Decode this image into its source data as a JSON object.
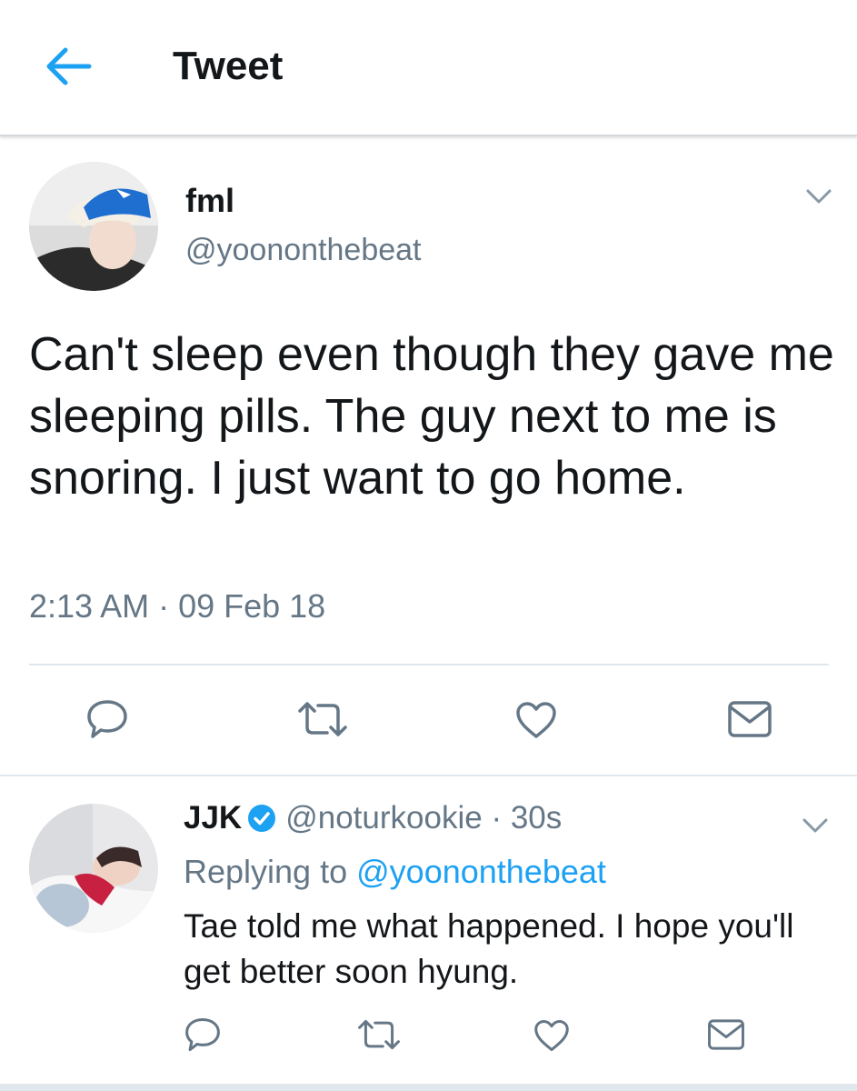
{
  "header": {
    "title": "Tweet",
    "back_icon": "arrow-left-icon"
  },
  "colors": {
    "accent": "#1da1f2",
    "text": "#14171a",
    "muted": "#657786",
    "divider": "#e1e8ed"
  },
  "tweet": {
    "display_name": "fml",
    "handle": "@yoononthebeat",
    "text": "Can't sleep even though they gave me sleeping pills. The guy next to me is snoring. I just want to go home.",
    "timestamp": "2:13 AM · 09 Feb 18",
    "actions": [
      "reply-icon",
      "retweet-icon",
      "like-icon",
      "message-icon"
    ]
  },
  "reply": {
    "display_name": "JJK",
    "handle": "@noturkookie",
    "time": "· 30s",
    "replying_prefix": "Replying to",
    "replying_to": "@yoononthebeat",
    "text": "Tae told me what happened. I hope you'll get better soon hyung.",
    "verified": true
  }
}
